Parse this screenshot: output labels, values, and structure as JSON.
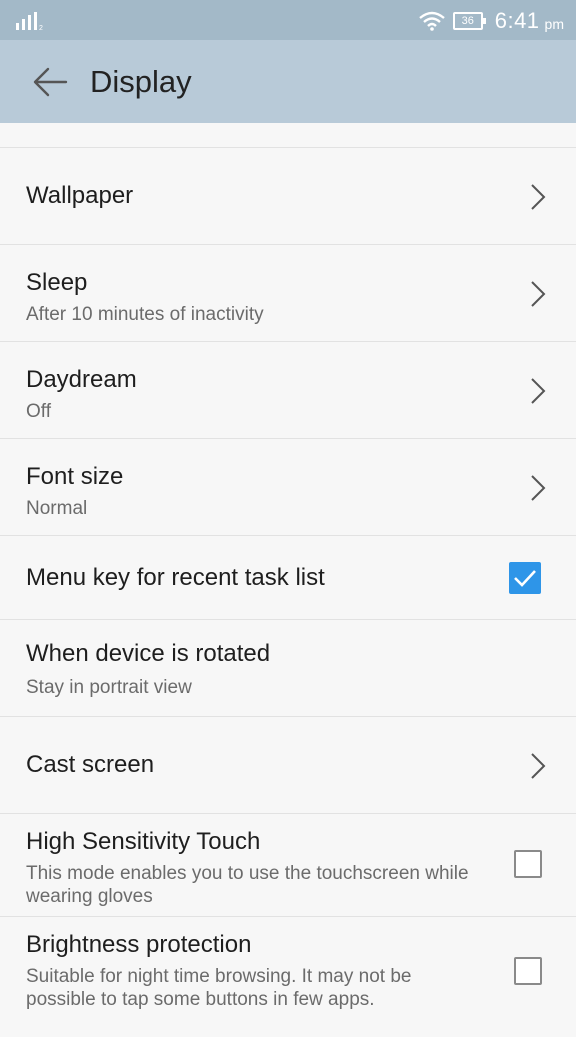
{
  "status": {
    "battery": "36",
    "time": "6:41",
    "ampm": "pm"
  },
  "header": {
    "title": "Display"
  },
  "rows": [
    {
      "title": "Wallpaper"
    },
    {
      "title": "Sleep",
      "subtitle": "After 10 minutes of inactivity"
    },
    {
      "title": "Daydream",
      "subtitle": "Off"
    },
    {
      "title": "Font size",
      "subtitle": "Normal"
    },
    {
      "title": "Menu key for recent task list",
      "checked": true
    },
    {
      "title": "When device is rotated",
      "subtitle": "Stay in portrait view"
    },
    {
      "title": "Cast screen"
    },
    {
      "title": "High Sensitivity Touch",
      "subtitle": "This mode enables you to use the touchscreen while wearing gloves",
      "checked": false
    },
    {
      "title": "Brightness protection",
      "subtitle": "Suitable for night time browsing. It may not be possible to tap some buttons in few apps.",
      "checked": false
    }
  ],
  "colors": {
    "status_bar": "#a3b9c8",
    "app_bar": "#b8cad8",
    "accent": "#2e95e8"
  }
}
